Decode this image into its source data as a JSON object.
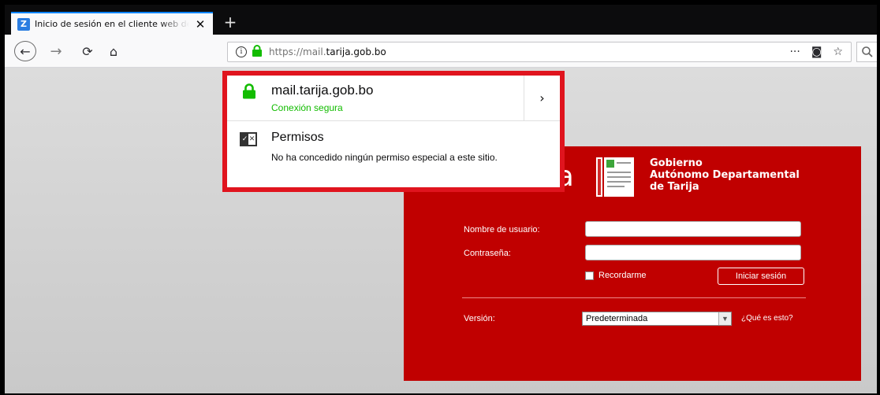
{
  "browser": {
    "tab": {
      "favicon_letter": "Z",
      "title": "Inicio de sesión en el cliente web de Zimbra",
      "close_glyph": "✕"
    },
    "new_tab_glyph": "+",
    "nav": {
      "back_glyph": "←",
      "forward_glyph": "→",
      "reload_glyph": "⟳",
      "home_glyph": "⌂"
    },
    "url": {
      "prefix": "https://mail.",
      "host": "tarija.gob.bo"
    },
    "page_actions": {
      "more_glyph": "···",
      "pocket_glyph": "◙",
      "bookmark_glyph": "☆"
    },
    "search_glyph": "🔍"
  },
  "identity_popup": {
    "host": "mail.tarija.gob.bo",
    "connection": "Conexión segura",
    "more_glyph": "›",
    "permissions_title": "Permisos",
    "permissions_desc": "No ha concedido ningún permiso especial a este sitio."
  },
  "login": {
    "brand": "ra",
    "gov_name": [
      "Gobierno",
      "Autónomo Departamental",
      "de Tarija"
    ],
    "username_label": "Nombre de usuario:",
    "password_label": "Contraseña:",
    "remember_label": "Recordarme",
    "login_button": "Iniciar sesión",
    "version_label": "Versión:",
    "version_value": "Predeterminada",
    "whats_this": "¿Qué es esto?"
  },
  "colors": {
    "panel_red": "#c00000",
    "highlight_red": "#e0141e",
    "secure_green": "#12bc00"
  }
}
